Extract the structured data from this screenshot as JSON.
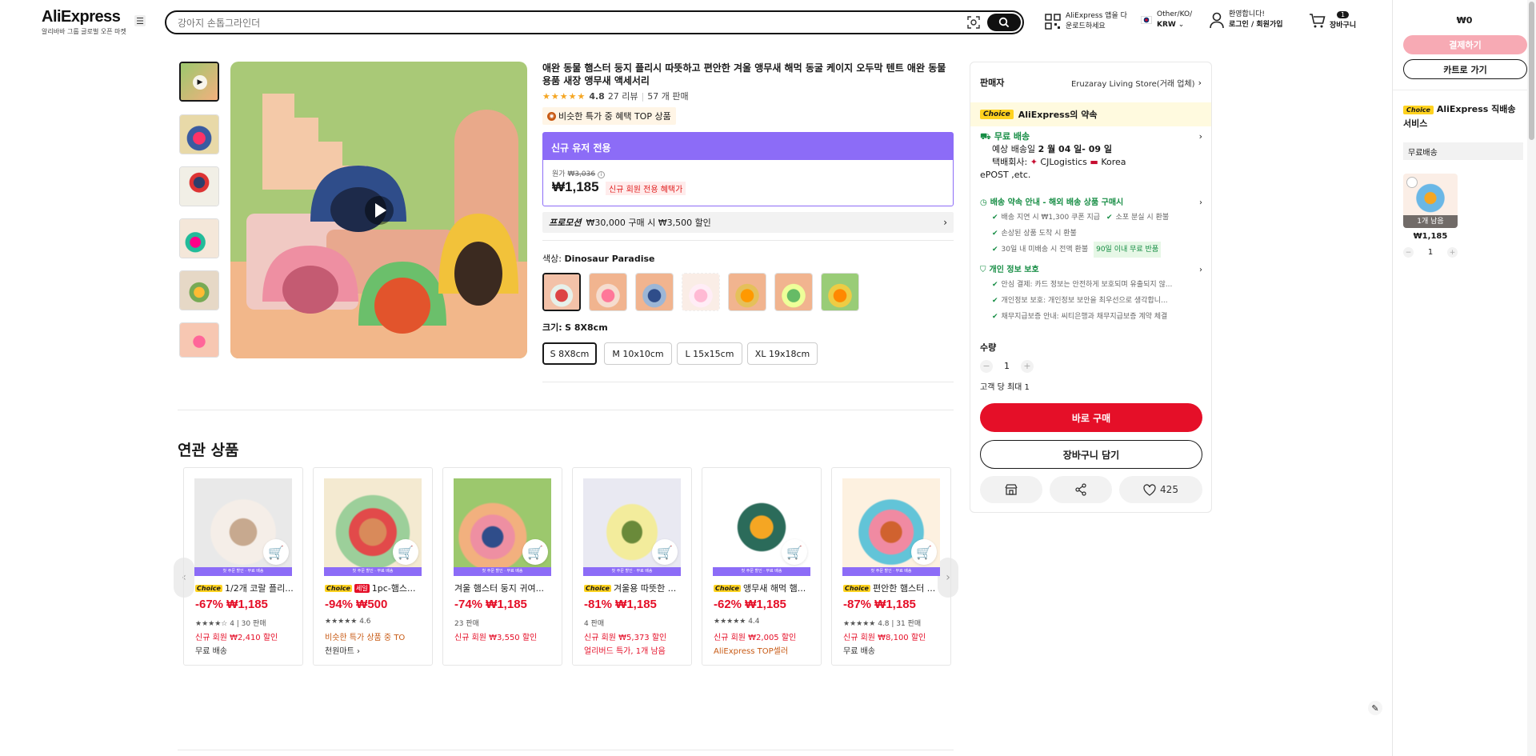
{
  "header": {
    "logo": "AliExpress",
    "logo_sub": "알리바바 그룹 글로벌 오픈 마켓",
    "search_placeholder": "강아지 손톱그라인더",
    "app_line1": "AliExpress 앱을 다",
    "app_line2": "운로드하세요",
    "locale_line1": "Other/KO/",
    "locale_line2": "KRW",
    "welcome": "환영합니다!",
    "login": "로그인 / 회원가입",
    "cart_count": "1",
    "cart_label": "장바구니"
  },
  "product": {
    "title": "애완 동물 햄스터 둥지 플리시 따뜻하고 편안한 겨울 앵무새 해먹 동굴 케이지 오두막 텐트 애완 동물 용품 새장 앵무새 액세서리",
    "rating": "4.8",
    "reviews": "27 리뷰",
    "sold": "57 개 판매",
    "badge": "비슷한 특가 중 혜택 TOP 상품",
    "newuser_header": "신규 유저 전용",
    "orig_label": "원가",
    "orig_price": "₩3,036",
    "price": "₩1,185",
    "price_tag": "신규 회원 전용 혜택가",
    "promo_label": "프로모션",
    "promo_text": "₩30,000 구매 시 ₩3,500 할인",
    "color_label": "색상:",
    "color_value": "Dinosaur Paradise",
    "size_label": "크기:",
    "size_value": "S 8X8cm",
    "sizes": [
      "S 8X8cm",
      "M 10x10cm",
      "L 15x15cm",
      "XL 19x18cm"
    ]
  },
  "panel": {
    "seller_label": "판매자",
    "seller_name": "Eruzaray Living Store(거래 업체)",
    "choice": "Choice",
    "promise": "AliExpress의 약속",
    "free_ship": "무료 배송",
    "eta_prefix": "예상 배송일",
    "eta": "2 월 04 일- 09 일",
    "carrier_prefix": "택배회사:",
    "carrier": "CJLogistics",
    "carrier_country": "Korea",
    "carrier_2": "ePOST ,etc.",
    "delivery_title": "배송 약속 안내 - 해외 배송 상품 구매시",
    "delivery_items": [
      "배송 지연 시 ₩1,300 쿠폰 지급",
      "소포 분실 시 환불",
      "손상된 상품 도착 시 환불",
      "30일 내 미배송 시 전액 환불"
    ],
    "delivery_badge": "90일 이내 무료 반품",
    "privacy_title": "개인 정보 보호",
    "privacy_items": [
      "안심 결제: 카드 정보는 안전하게 보호되며 유출되지 않...",
      "개인정보 보호: 개인정보 보안을 최우선으로 생각합니...",
      "채무지급보증 안내: 씨티은행과 채무지급보증 계약 체결"
    ],
    "qty_label": "수량",
    "qty": "1",
    "limit": "고객 당 최대 1",
    "buy": "바로 구매",
    "cart": "장바구니 담기",
    "wishes": "425"
  },
  "related": {
    "title": "연관 상품",
    "strip": "첫 주문 할인 · 무료 배송",
    "items": [
      {
        "choice": "Choice",
        "sale": "",
        "name": "1/2개 코랄 플리...",
        "price": "-67% ₩1,185",
        "rating": "★★★★☆ 4 | 30 판매",
        "promo": "신규 회원 ₩2,410 할인",
        "extra": "무료 배송"
      },
      {
        "choice": "Choice",
        "sale": "세일",
        "name": "1pc-햄스...",
        "price": "-94% ₩500",
        "rating": "★★★★★ 4.6",
        "promo": "비슷한 특가 상품 중 TO",
        "extra": "천원마트 ›"
      },
      {
        "choice": "",
        "sale": "",
        "name": "겨울 햄스터 둥지 귀여...",
        "price": "-74% ₩1,185",
        "rating": "23 판매",
        "promo": "신규 회원 ₩3,550 할인",
        "extra": ""
      },
      {
        "choice": "Choice",
        "sale": "",
        "name": "겨울용 따뜻한 ...",
        "price": "-81% ₩1,185",
        "rating": "4 판매",
        "promo": "신규 회원 ₩5,373 할인",
        "extra": "얼리버드 특가, 1개 남음"
      },
      {
        "choice": "Choice",
        "sale": "",
        "name": "앵무새 해먹 햄...",
        "price": "-62% ₩1,185",
        "rating": "★★★★★ 4.4",
        "promo": "신규 회원 ₩2,005 할인",
        "extra": "AliExpress TOP셀러"
      },
      {
        "choice": "Choice",
        "sale": "",
        "name": "편안한 햄스터 ...",
        "price": "-87% ₩1,185",
        "rating": "★★★★★ 4.8 | 31 판매",
        "promo": "신규 회원 ₩8,100 할인",
        "extra": "무료 배송"
      }
    ]
  },
  "sidecart": {
    "total": "₩0",
    "pay": "결제하기",
    "go_cart": "카트로 가기",
    "choice": "Choice",
    "service": "AliExpress 직배송 서비스",
    "free_ship": "무료배송",
    "stock": "1개 남음",
    "price": "₩1,185",
    "qty": "1"
  },
  "colors": {
    "accent": "#e50f28",
    "purple": "#8c6cf7",
    "choice": "#ffd21f",
    "green": "#168d44"
  }
}
